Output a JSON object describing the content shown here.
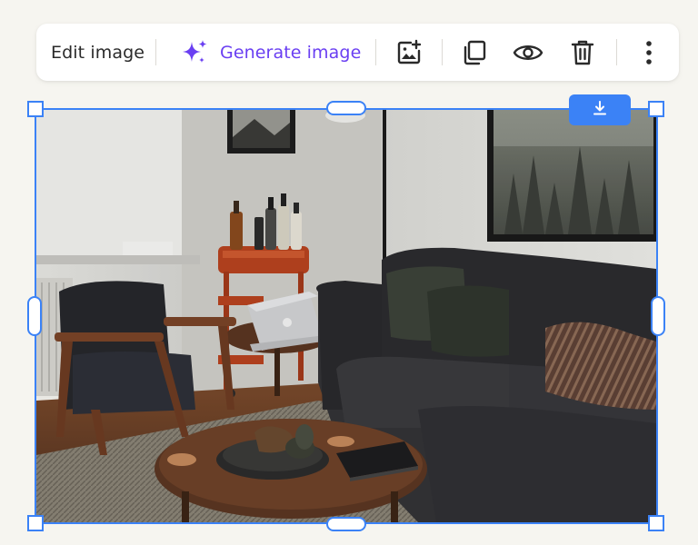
{
  "toolbar": {
    "edit_label": "Edit image",
    "generate_label": "Generate image",
    "icons": {
      "generate": "sparkle-icon",
      "add_image": "image-plus-icon",
      "duplicate": "copy-icon",
      "preview": "eye-icon",
      "delete": "trash-icon",
      "more": "more-vertical-icon"
    }
  },
  "image": {
    "download_icon": "download-icon",
    "description_color_accent": "#3b82f6"
  },
  "colors": {
    "accent": "#3b82f6",
    "generate": "#6a3ff2",
    "background": "#f6f5f0"
  }
}
